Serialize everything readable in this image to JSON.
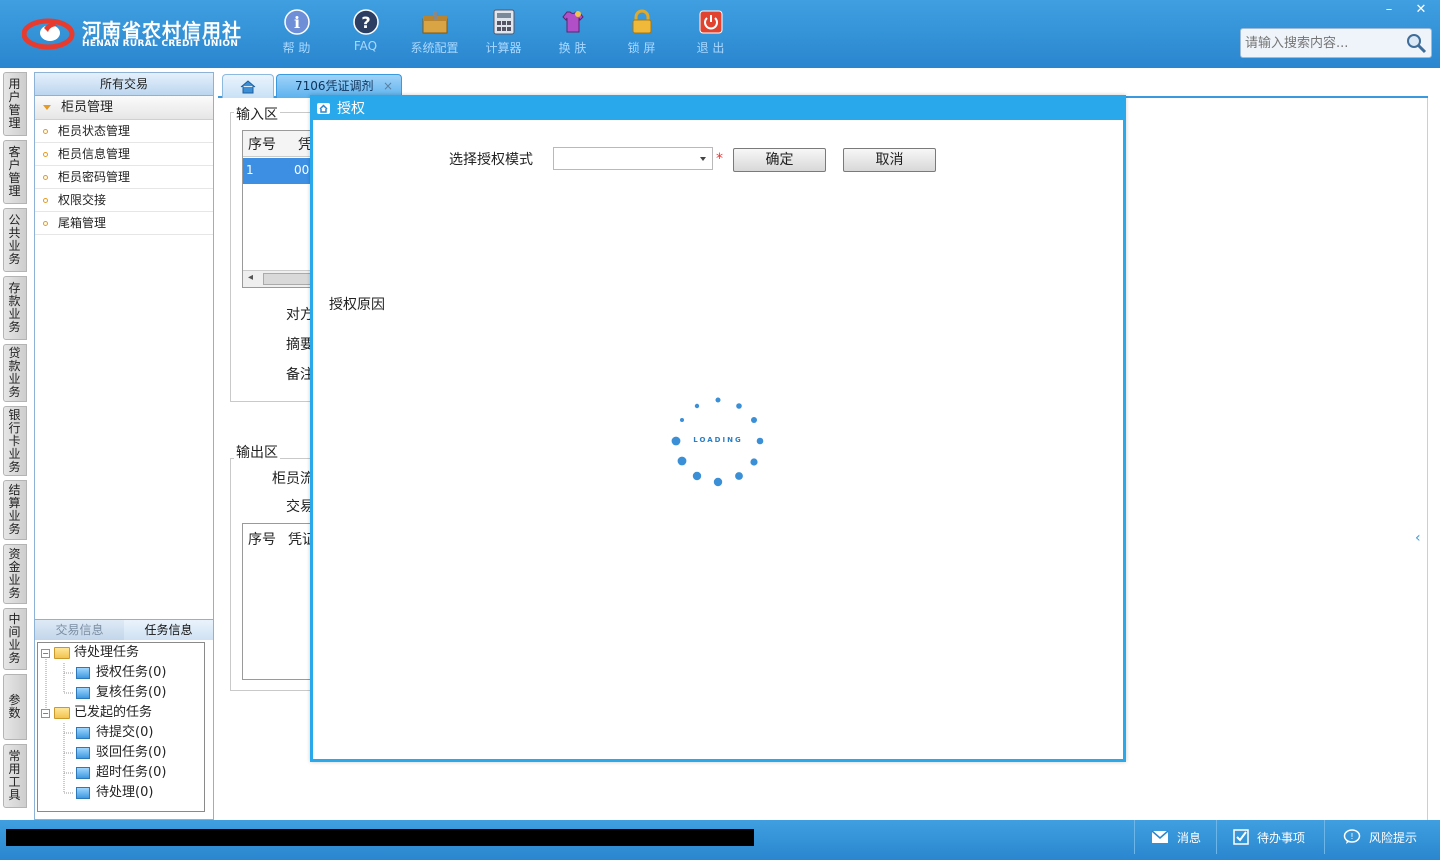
{
  "header": {
    "logo_cn": "河南省农村信用社",
    "logo_en": "HENAN RURAL CREDIT UNION",
    "tools": [
      {
        "label": "帮 助",
        "icon": "help-icon"
      },
      {
        "label": "FAQ",
        "icon": "faq-icon"
      },
      {
        "label": "系统配置",
        "icon": "config-icon"
      },
      {
        "label": "计算器",
        "icon": "calculator-icon"
      },
      {
        "label": "换 肤",
        "icon": "skin-icon"
      },
      {
        "label": "锁 屏",
        "icon": "lock-icon"
      },
      {
        "label": "退 出",
        "icon": "exit-icon"
      }
    ],
    "search_placeholder": "请输入搜索内容...",
    "minimize": "–",
    "close": "✕"
  },
  "vtabs": [
    "用户管理",
    "客户管理",
    "公共业务",
    "存款业务",
    "贷款业务",
    "银行卡业务",
    "结算业务",
    "资金业务",
    "中间业务",
    "参数",
    "常用工具"
  ],
  "leftpanel": {
    "title": "所有交易",
    "group": "柜员管理",
    "items": [
      "柜员状态管理",
      "柜员信息管理",
      "柜员密码管理",
      "权限交接",
      "尾箱管理"
    ],
    "bottom_tabs": [
      "交易信息",
      "任务信息"
    ],
    "tree": {
      "pending": "待处理任务",
      "auth": "授权任务(0)",
      "review": "复核任务(0)",
      "initiated": "已发起的任务",
      "submit": "待提交(0)",
      "rejected": "驳回任务(0)",
      "timeout": "超时任务(0)",
      "todo": "待处理(0)"
    }
  },
  "tabs": {
    "doc_tab": "7106凭证调剂",
    "doc_tab_close": "×"
  },
  "main": {
    "input_area": "输入区",
    "col_seq": "序号",
    "col_voucher": "凭",
    "row_seq": "1",
    "row_val": "00.",
    "label_counter": "对方",
    "label_summary": "摘要",
    "label_note": "备注",
    "output_area": "输出区",
    "label_teller": "柜员流",
    "label_trade": "交易",
    "out_col_seq": "序号",
    "out_col_voucher": "凭证"
  },
  "dialog": {
    "title": "授权",
    "mode_label": "选择授权模式",
    "required_mark": "*",
    "ok": "确定",
    "cancel": "取消",
    "reason_label": "授权原因",
    "loading": "LOADING"
  },
  "statusbar": {
    "message": "消息",
    "todo": "待办事项",
    "risk": "风险提示"
  }
}
